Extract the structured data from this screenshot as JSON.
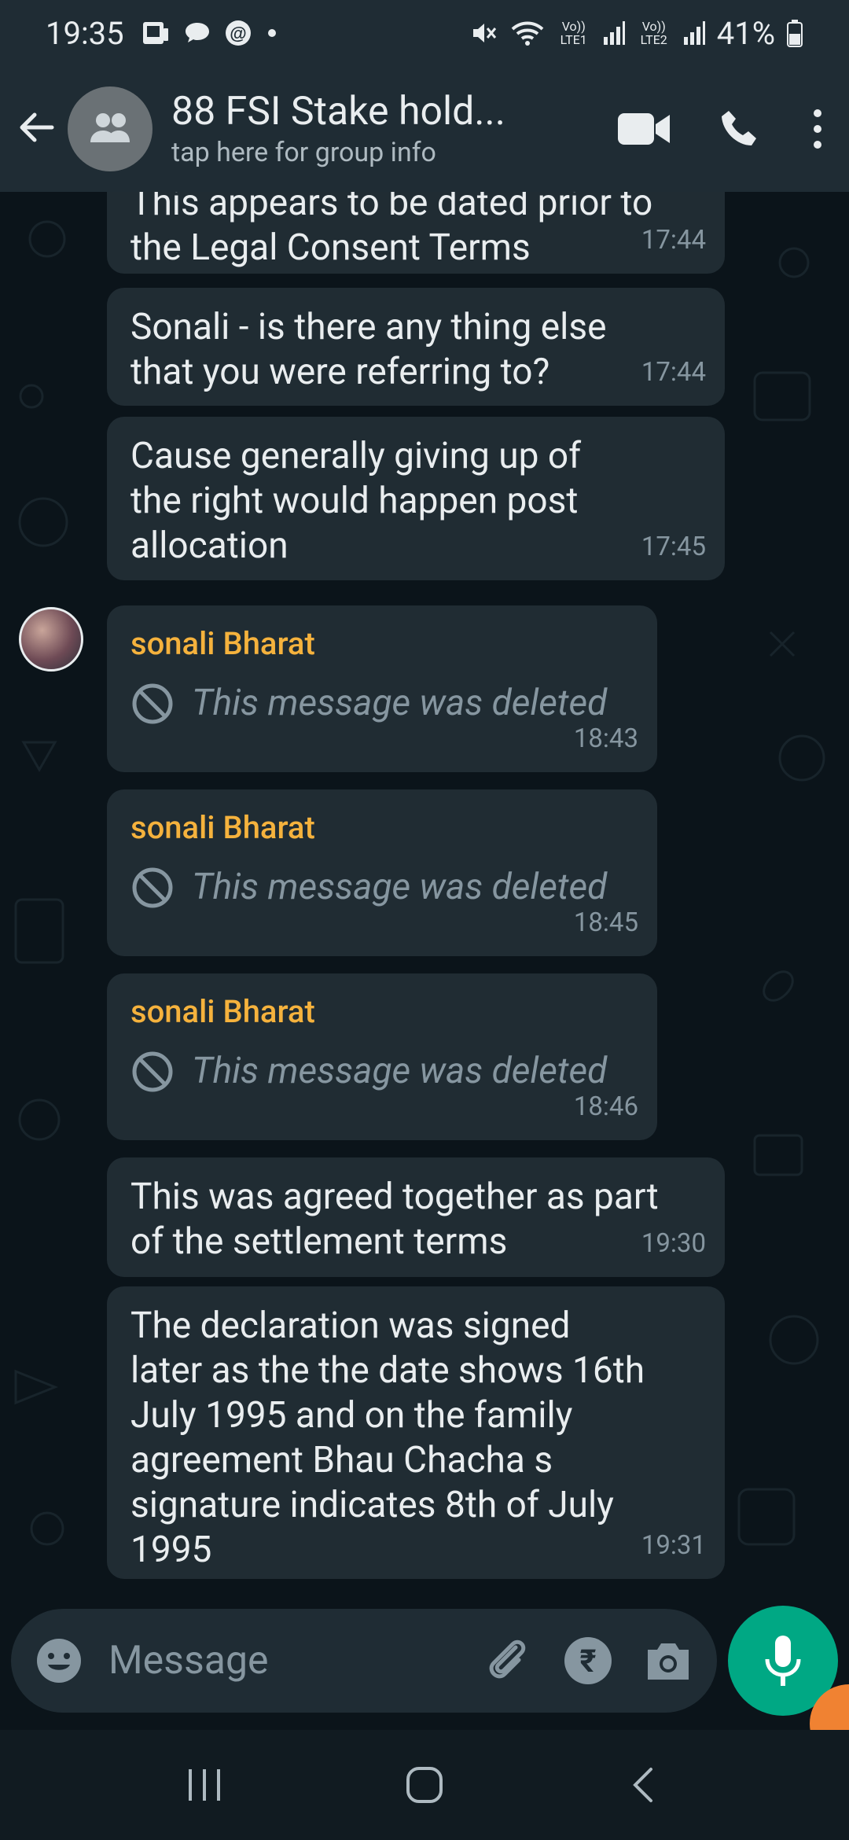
{
  "status_bar": {
    "time": "19:35",
    "battery": "41%",
    "sim1_label": "Vo)) LTE1",
    "sim2_label": "Vo)) LTE2"
  },
  "header": {
    "title": "88 FSI Stake hold...",
    "subtitle": "tap here for group info"
  },
  "messages": [
    {
      "text": "This appears to be dated prior to\nthe Legal Consent Terms",
      "time": "17:44"
    },
    {
      "text": "Sonali - is there any thing else\nthat you were referring to?",
      "time": "17:44"
    },
    {
      "text": "Cause generally giving up of\nthe right would happen post\nallocation",
      "time": "17:45"
    },
    {
      "sender": "sonali Bharat",
      "text": "This message was deleted",
      "time": "18:43"
    },
    {
      "sender": "sonali Bharat",
      "text": "This message was deleted",
      "time": "18:45"
    },
    {
      "sender": "sonali Bharat",
      "text": "This message was deleted",
      "time": "18:46"
    },
    {
      "text": "This was agreed together as part\nof the settlement terms",
      "time": "19:30"
    },
    {
      "text": "The declaration was signed\nlater as the the date shows 16th\nJuly 1995 and on the family\nagreement  Bhau Chacha s\nsignature indicates  8th of July\n1995",
      "time": "19:31"
    }
  ],
  "input": {
    "placeholder": "Message",
    "currency_symbol": "₹"
  },
  "colors": {
    "background": "#0b141a",
    "bar": "#1f2c34",
    "bubble": "#202c33",
    "sender_name": "#f5b23d",
    "accent": "#00a884"
  }
}
